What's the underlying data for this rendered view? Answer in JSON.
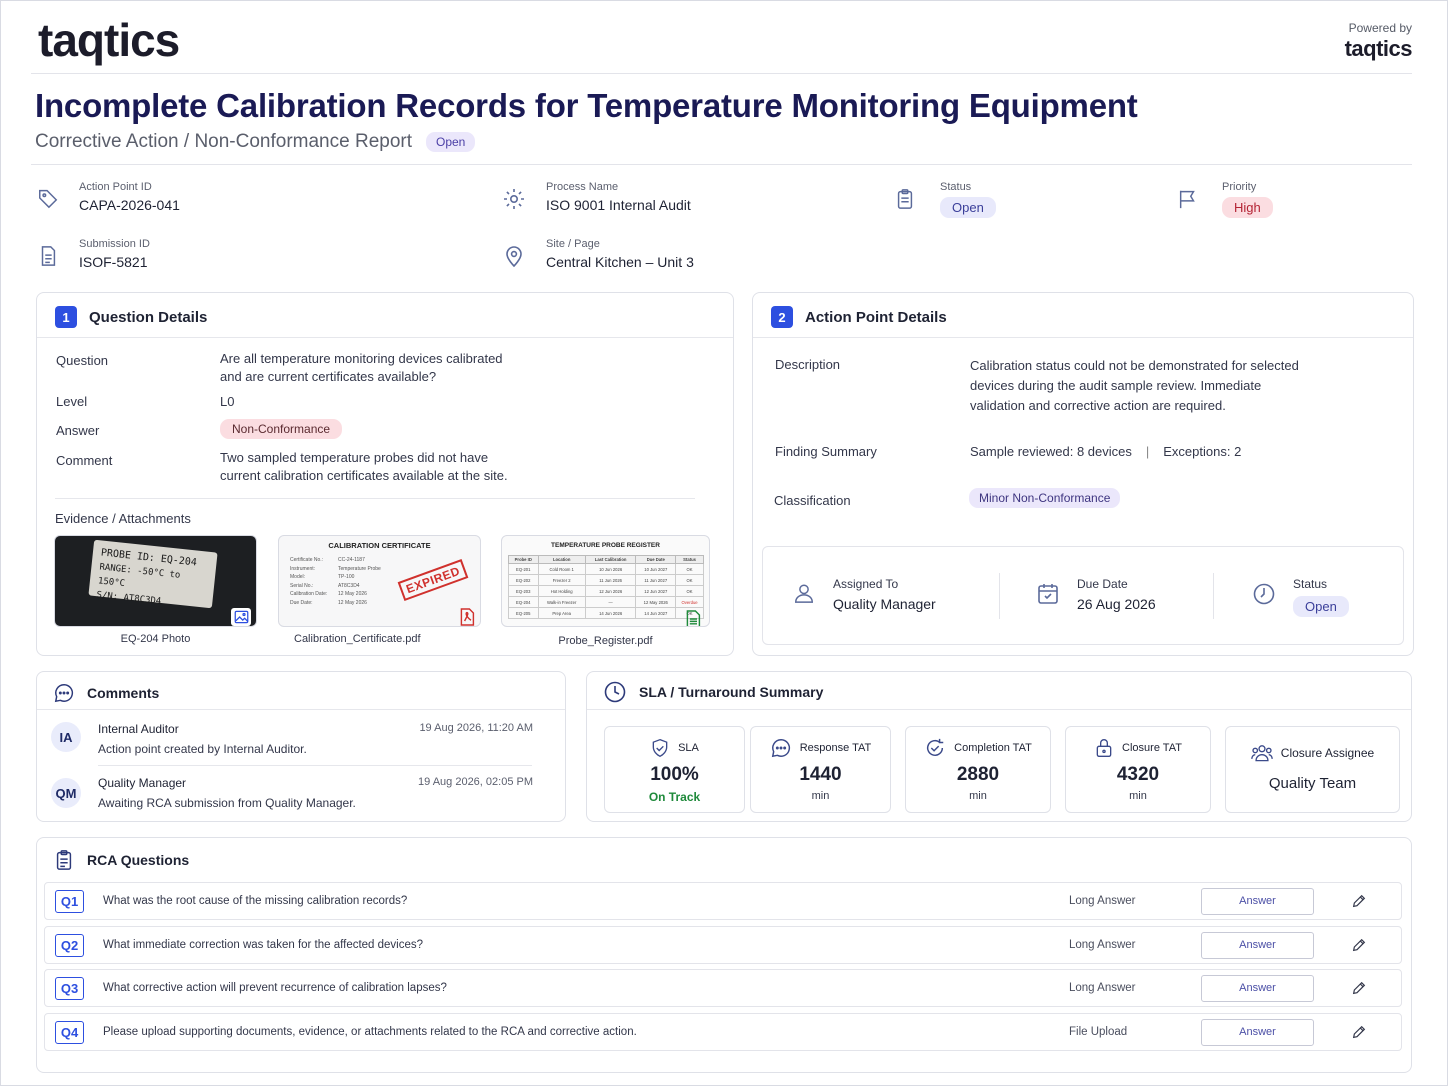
{
  "brand": {
    "logo": "taqtics",
    "powered_by": "Powered by",
    "powered_logo": "taqtics"
  },
  "report": {
    "title": "Incomplete Calibration Records for Temperature Monitoring Equipment",
    "subtitle": "Corrective Action / Non-Conformance Report",
    "status_badge": "Open"
  },
  "meta": {
    "action_point_id": {
      "label": "Action Point ID",
      "value": "CAPA-2026-041"
    },
    "process_name": {
      "label": "Process Name",
      "value": "ISO 9001 Internal Audit"
    },
    "status": {
      "label": "Status",
      "value": "Open"
    },
    "priority": {
      "label": "Priority",
      "value": "High"
    },
    "submission_id": {
      "label": "Submission ID",
      "value": "ISOF-5821"
    },
    "site": {
      "label": "Site / Page",
      "value": "Central Kitchen – Unit 3"
    }
  },
  "question_details": {
    "number": "1",
    "heading": "Question Details",
    "question_label": "Question",
    "question_line1": "Are all temperature monitoring devices calibrated",
    "question_line2": "and are current certificates available?",
    "level_label": "Level",
    "level": "L0",
    "answer_label": "Answer",
    "answer": "Non-Conformance",
    "comment_label": "Comment",
    "comment_line1": "Two sampled temperature probes did not have",
    "comment_line2": "current calibration certificates available at the site.",
    "evidence_heading": "Evidence / Attachments",
    "attachments": [
      {
        "caption": "EQ-204 Photo",
        "icon": "image-icon"
      },
      {
        "caption": "Calibration_Certificate.pdf",
        "icon": "pdf-icon"
      },
      {
        "caption": "Probe_Register.pdf",
        "icon": "sheet-icon"
      }
    ],
    "photo_text": {
      "line1": "PROBE ID:  EQ-204",
      "line2": "RANGE: -50°C to 150°C",
      "line3": "S/N: AT8C3D4"
    },
    "certificate": {
      "title": "CALIBRATION CERTIFICATE",
      "stamp": "EXPIRED",
      "fields": [
        [
          "Certificate No.:",
          "CC-24-1187"
        ],
        [
          "Instrument:",
          "Temperature Probe"
        ],
        [
          "Model:",
          "TP-100"
        ],
        [
          "Serial No.:",
          "AT8C3D4"
        ],
        [
          "Calibration Date:",
          "12 May 2026"
        ],
        [
          "Due Date:",
          "12 May 2026"
        ]
      ]
    },
    "register": {
      "title": "TEMPERATURE PROBE REGISTER",
      "headers": [
        "Probe ID",
        "Location",
        "Last Calibration",
        "Due Date",
        "Status"
      ],
      "rows": [
        [
          "EQ-201",
          "Cold Room 1",
          "10 Jun 2026",
          "10 Jun 2027",
          "OK"
        ],
        [
          "EQ-202",
          "Freezer 2",
          "11 Jun 2026",
          "11 Jun 2027",
          "OK"
        ],
        [
          "EQ-203",
          "Hot Holding",
          "12 Jun 2026",
          "12 Jun 2027",
          "OK"
        ],
        [
          "EQ-204",
          "Walk-in Freezer",
          "—",
          "12 May 2026",
          "Overdue"
        ],
        [
          "EQ-205",
          "Prep Area",
          "14 Jun 2026",
          "14 Jun 2027",
          "OK"
        ]
      ]
    }
  },
  "action_point": {
    "number": "2",
    "heading": "Action Point Details",
    "description_label": "Description",
    "description_line1": "Calibration status could not be demonstrated for selected",
    "description_line2": "devices during the audit sample review. Immediate",
    "description_line3": "validation and corrective action are required.",
    "finding_label": "Finding Summary",
    "finding_sample": "Sample reviewed: 8 devices",
    "finding_sep": "|",
    "finding_exceptions": "Exceptions: 2",
    "classification_label": "Classification",
    "classification": "Minor Non-Conformance",
    "assigned_label": "Assigned To",
    "assigned_value": "Quality Manager",
    "due_label": "Due Date",
    "due_value": "26 Aug 2026",
    "status_label": "Status",
    "status_value": "Open"
  },
  "comments": {
    "heading": "Comments",
    "items": [
      {
        "initials": "IA",
        "author": "Internal Auditor",
        "time": "19 Aug 2026, 11:20 AM",
        "text": "Action point created by Internal Auditor."
      },
      {
        "initials": "QM",
        "author": "Quality Manager",
        "time": "19 Aug 2026, 02:05 PM",
        "text": "Awaiting RCA submission from Quality Manager."
      }
    ]
  },
  "sla": {
    "heading": "SLA / Turnaround Summary",
    "boxes": [
      {
        "label": "SLA",
        "value": "100%",
        "sub": "On Track",
        "icon": "shield-check-icon"
      },
      {
        "label": "Response TAT",
        "value": "1440",
        "sub": "min",
        "icon": "chat-icon"
      },
      {
        "label": "Completion TAT",
        "value": "2880",
        "sub": "min",
        "icon": "cycle-check-icon"
      },
      {
        "label": "Closure TAT",
        "value": "4320",
        "sub": "min",
        "icon": "lock-icon"
      },
      {
        "label": "Closure Assignee",
        "value": "Quality Team",
        "sub": "",
        "icon": "team-icon"
      }
    ]
  },
  "rca": {
    "heading": "RCA Questions",
    "answer_label": "Answer",
    "questions": [
      {
        "id": "Q1",
        "text": "What was the root cause of the missing calibration records?",
        "type": "Long Answer"
      },
      {
        "id": "Q2",
        "text": "What immediate correction was taken for the affected devices?",
        "type": "Long Answer"
      },
      {
        "id": "Q3",
        "text": "What corrective action will prevent recurrence of calibration lapses?",
        "type": "Long Answer"
      },
      {
        "id": "Q4",
        "text": "Please upload supporting documents, evidence, or attachments related to the RCA and corrective action.",
        "type": "File Upload"
      }
    ]
  },
  "colors": {
    "primary": "#2d4fe0",
    "title": "#1a1a55",
    "accent": "#7b3fe4",
    "danger": "#b42334",
    "success": "#1f8a3b"
  }
}
